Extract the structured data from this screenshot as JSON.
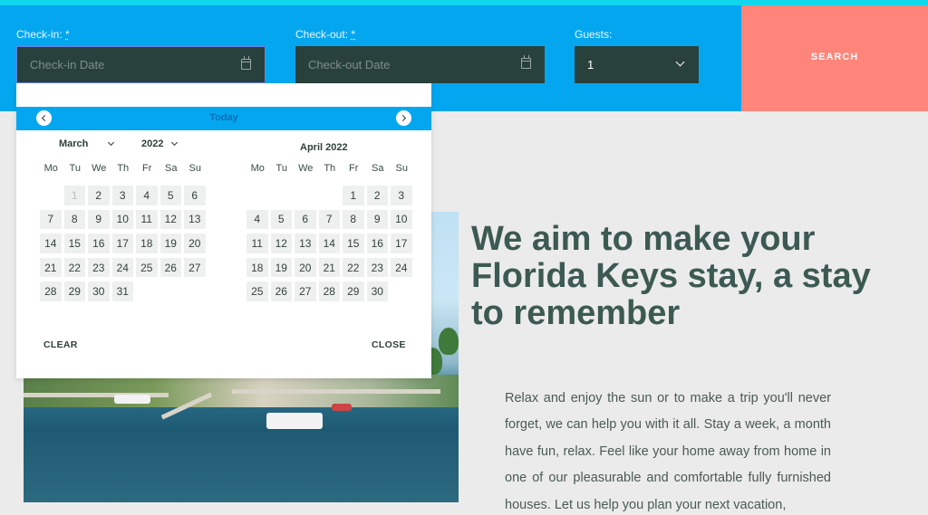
{
  "booking": {
    "checkin": {
      "label": "Check-in:",
      "required_mark": "*",
      "placeholder": "Check-in Date"
    },
    "checkout": {
      "label": "Check-out:",
      "required_mark": "*",
      "placeholder": "Check-out Date"
    },
    "guests": {
      "label": "Guests:",
      "value": "1"
    },
    "search_label": "SEARCH"
  },
  "datepicker": {
    "today_label": "Today",
    "month_select": "March",
    "year_select": "2022",
    "second_month_title": "April 2022",
    "weekdays": [
      "Mo",
      "Tu",
      "We",
      "Th",
      "Fr",
      "Sa",
      "Su"
    ],
    "march": {
      "offset": 1,
      "days": 31,
      "disabled": [
        1
      ]
    },
    "april": {
      "offset": 4,
      "days": 30,
      "disabled": []
    },
    "clear_label": "CLEAR",
    "close_label": "CLOSE"
  },
  "content": {
    "headline": "We aim to make your Florida Keys stay, a stay to remember",
    "paragraph": "Relax and enjoy the sun or to make a trip you'll never forget, we can help you with it all. Stay a week, a month have fun, relax. Feel like your home away from home in one of our pleasurable and comfortable fully furnished houses. Let us help you plan your next vacation,"
  },
  "colors": {
    "booking_bar": "#04a7ef",
    "search_button": "#ff857a",
    "field_bg": "#29413c",
    "headline": "#3d5a52"
  }
}
